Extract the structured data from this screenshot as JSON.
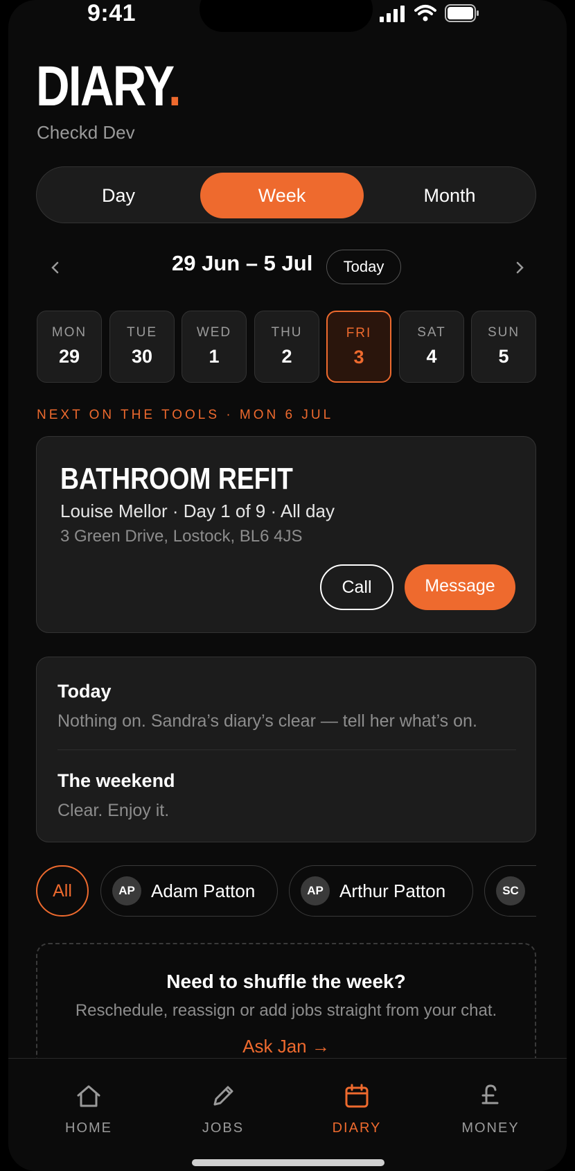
{
  "status_bar": {
    "time": "9:41"
  },
  "header": {
    "title": "DIARY",
    "title_dot": ".",
    "subtitle": "Checkd Dev"
  },
  "view_toggle": {
    "options": [
      "Day",
      "Week",
      "Month"
    ],
    "selected": "Week"
  },
  "week_nav": {
    "range": "29 Jun – 5 Jul",
    "today_label": "Today",
    "prev_icon": "chevron-left-icon",
    "next_icon": "chevron-right-icon"
  },
  "days": [
    {
      "name": "MON",
      "date": "29"
    },
    {
      "name": "TUE",
      "date": "30"
    },
    {
      "name": "WED",
      "date": "1"
    },
    {
      "name": "THU",
      "date": "2"
    },
    {
      "name": "FRI",
      "date": "3"
    },
    {
      "name": "SAT",
      "date": "4"
    },
    {
      "name": "SUN",
      "date": "5"
    }
  ],
  "selected_day": "FRI",
  "next_label": "NEXT ON THE TOOLS · MON 6 JUL",
  "job": {
    "title": "BATHROOM REFIT",
    "meta": "Louise Mellor · Day 1 of 9 · All day",
    "address": "3 Green Drive, Lostock, BL6 4JS",
    "call_label": "Call",
    "message_label": "Message"
  },
  "summary": {
    "today_heading": "Today",
    "today_text": "Nothing on. Sandra’s diary’s clear — tell her what’s on.",
    "weekend_heading": "The weekend",
    "weekend_text": "Clear. Enjoy it."
  },
  "filters": {
    "all_label": "All",
    "people": [
      {
        "initials": "AP",
        "name": "Adam Patton"
      },
      {
        "initials": "AP",
        "name": "Arthur Patton"
      },
      {
        "initials": "SC",
        "name": ""
      }
    ]
  },
  "ask": {
    "heading": "Need to shuffle the week?",
    "text": "Reschedule, reassign or add jobs straight from your chat.",
    "link": "Ask Jan →"
  },
  "tabs": [
    {
      "label": "HOME",
      "icon": "home-icon"
    },
    {
      "label": "JOBS",
      "icon": "pencil-icon"
    },
    {
      "label": "DIARY",
      "icon": "calendar-icon"
    },
    {
      "label": "MONEY",
      "icon": "pound-icon"
    }
  ],
  "active_tab": "DIARY",
  "colors": {
    "accent": "#ee6a2e",
    "background": "#0b0b0b",
    "card": "#1c1c1c"
  }
}
